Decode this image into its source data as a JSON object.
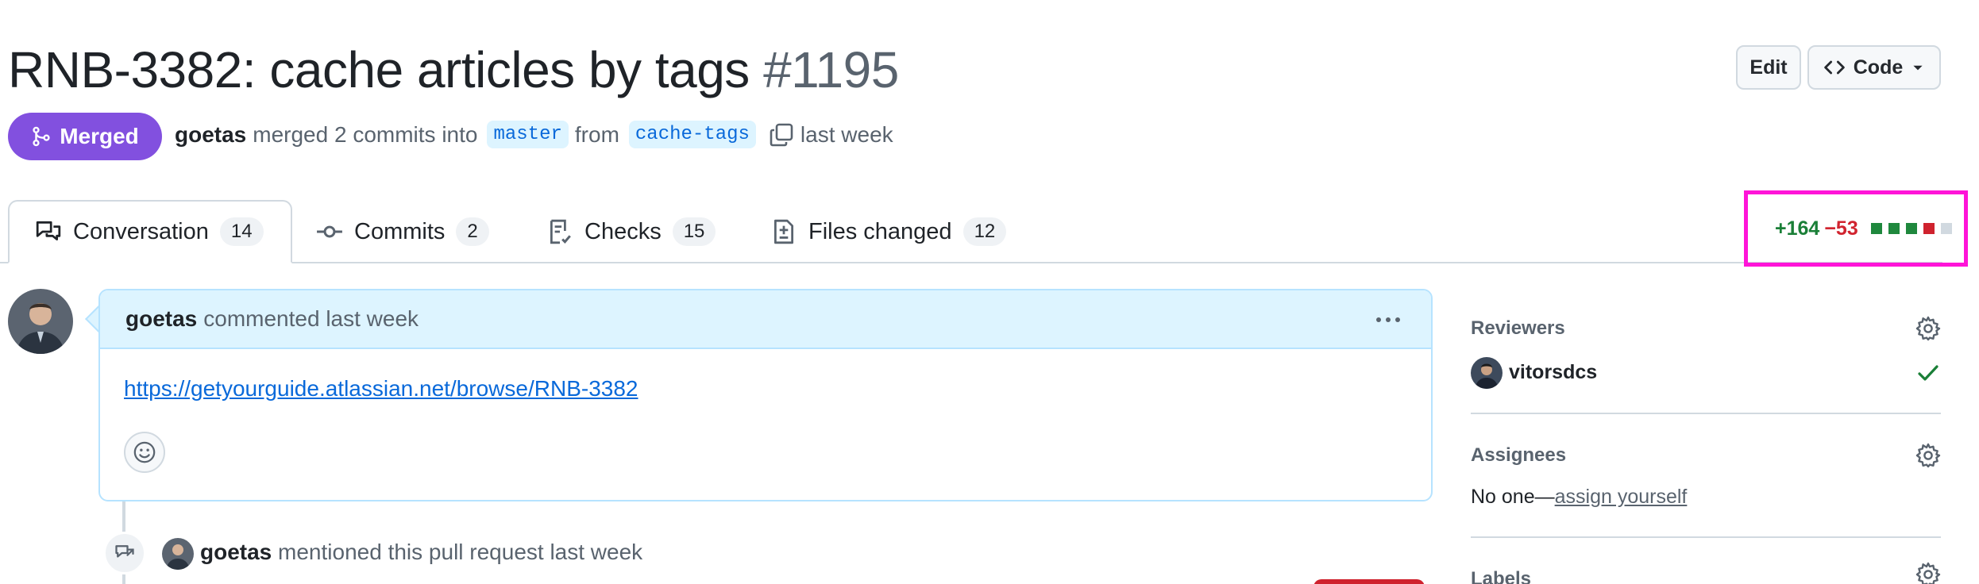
{
  "pr": {
    "title": "RNB-3382: cache articles by tags",
    "number": "#1195",
    "state": "Merged",
    "author": "goetas",
    "merge_text": "merged 2 commits into",
    "base_branch": "master",
    "from_text": "from",
    "head_branch": "cache-tags",
    "time": "last week"
  },
  "header_buttons": {
    "edit": "Edit",
    "code": "Code"
  },
  "tabs": [
    {
      "label": "Conversation",
      "count": "14",
      "icon": "comment-discussion-icon"
    },
    {
      "label": "Commits",
      "count": "2",
      "icon": "git-commit-icon"
    },
    {
      "label": "Checks",
      "count": "15",
      "icon": "checklist-icon"
    },
    {
      "label": "Files changed",
      "count": "12",
      "icon": "file-diff-icon"
    }
  ],
  "diffstat": {
    "additions": "+164",
    "deletions": "−53",
    "blocks": [
      "added",
      "added",
      "added",
      "deleted",
      "neutral"
    ],
    "colors": {
      "added": "#1f883d",
      "deleted": "#cf222e",
      "neutral": "#d1d9e0",
      "highlight": "#ff14d8"
    }
  },
  "comment": {
    "author": "goetas",
    "action": "commented last week",
    "body_link": "https://getyourguide.atlassian.net/browse/RNB-3382"
  },
  "timeline_event": {
    "author": "goetas",
    "text": "mentioned this pull request last week"
  },
  "sidebar": {
    "reviewers": {
      "heading": "Reviewers",
      "items": [
        {
          "name": "vitorsdcs",
          "status": "approved"
        }
      ]
    },
    "assignees": {
      "heading": "Assignees",
      "none_text": "No one—",
      "assign_link": "assign yourself"
    },
    "labels": {
      "heading": "Labels"
    }
  },
  "colors": {
    "merged": "#8250df",
    "link": "#0969da",
    "comment_header": "#ddf4ff"
  }
}
